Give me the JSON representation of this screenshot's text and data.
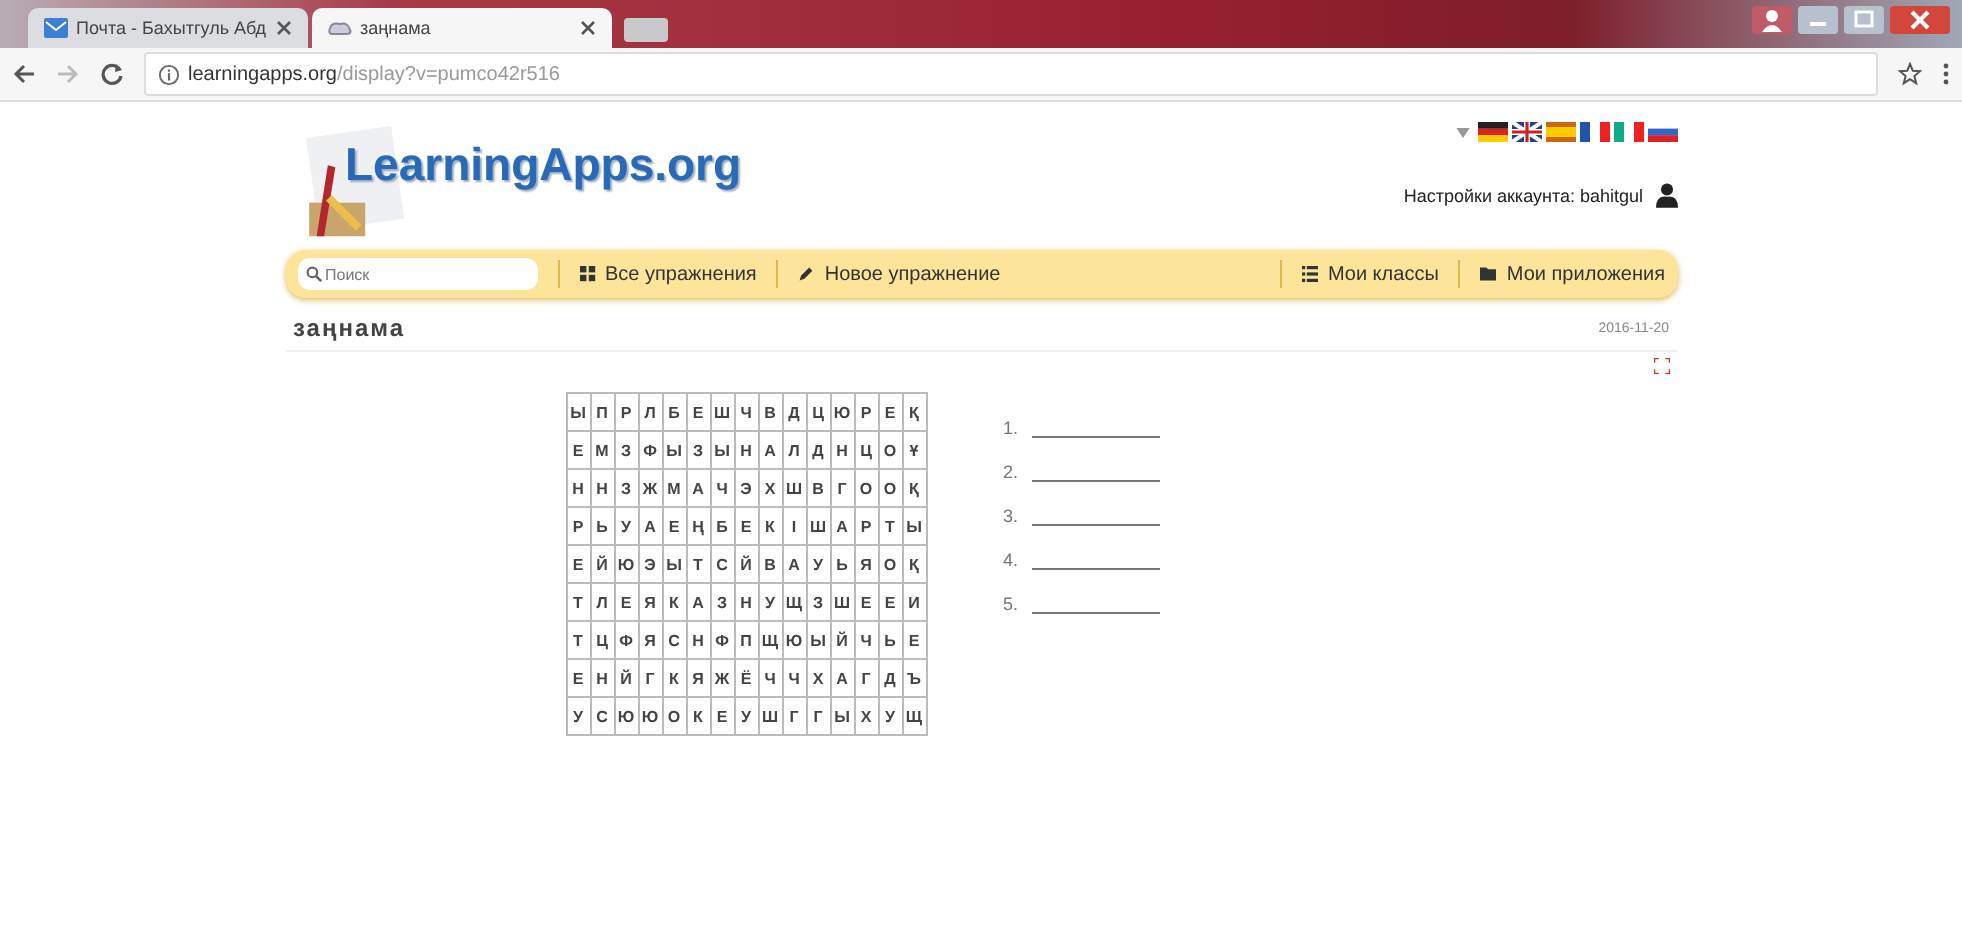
{
  "browser": {
    "tabs": [
      {
        "title": "Почта - Бахытгуль Абд",
        "selected": false
      },
      {
        "title": "заңнама",
        "selected": true
      }
    ],
    "url_host": "learningapps.org",
    "url_path": "/display?v=pumco42r516"
  },
  "header": {
    "logo": "LearningApps.org",
    "account": "Настройки аккаунта: bahitgul"
  },
  "nav": {
    "search_placeholder": "Поиск",
    "items": [
      {
        "label": "Все упражнения"
      },
      {
        "label": "Новое упражнение"
      },
      {
        "label": "Мои классы"
      },
      {
        "label": "Мои приложения"
      }
    ]
  },
  "app": {
    "title": "заңнама",
    "date": "2016-11-20"
  },
  "grid": [
    [
      "Ы",
      "П",
      "Р",
      "Л",
      "Б",
      "Е",
      "Ш",
      "Ч",
      "В",
      "Д",
      "Ц",
      "Ю",
      "Р",
      "Е",
      "Қ"
    ],
    [
      "Е",
      "М",
      "З",
      "Ф",
      "Ы",
      "З",
      "Ы",
      "Н",
      "А",
      "Л",
      "Д",
      "Н",
      "Ц",
      "О",
      "Ұ"
    ],
    [
      "Н",
      "Н",
      "З",
      "Ж",
      "М",
      "А",
      "Ч",
      "Э",
      "Х",
      "Ш",
      "В",
      "Г",
      "О",
      "О",
      "Қ"
    ],
    [
      "Р",
      "Ь",
      "У",
      "А",
      "Е",
      "Ң",
      "Б",
      "Е",
      "К",
      "І",
      "Ш",
      "А",
      "Р",
      "Т",
      "Ы"
    ],
    [
      "Е",
      "Й",
      "Ю",
      "Э",
      "Ы",
      "Т",
      "С",
      "Й",
      "В",
      "А",
      "У",
      "Ь",
      "Я",
      "О",
      "Қ"
    ],
    [
      "Т",
      "Л",
      "Е",
      "Я",
      "К",
      "А",
      "З",
      "Н",
      "У",
      "Щ",
      "З",
      "Ш",
      "Е",
      "Е",
      "И"
    ],
    [
      "Т",
      "Ц",
      "Ф",
      "Я",
      "С",
      "Н",
      "Ф",
      "П",
      "Щ",
      "Ю",
      "Ы",
      "Й",
      "Ч",
      "Ь",
      "Е"
    ],
    [
      "Е",
      "Н",
      "Й",
      "Г",
      "К",
      "Я",
      "Ж",
      "Ё",
      "Ч",
      "Ч",
      "Х",
      "А",
      "Г",
      "Д",
      "Ъ"
    ],
    [
      "У",
      "С",
      "Ю",
      "Ю",
      "О",
      "К",
      "Е",
      "У",
      "Ш",
      "Г",
      "Г",
      "Ы",
      "Х",
      "У",
      "Щ"
    ]
  ],
  "answers": [
    "1.",
    "2.",
    "3.",
    "4.",
    "5."
  ]
}
